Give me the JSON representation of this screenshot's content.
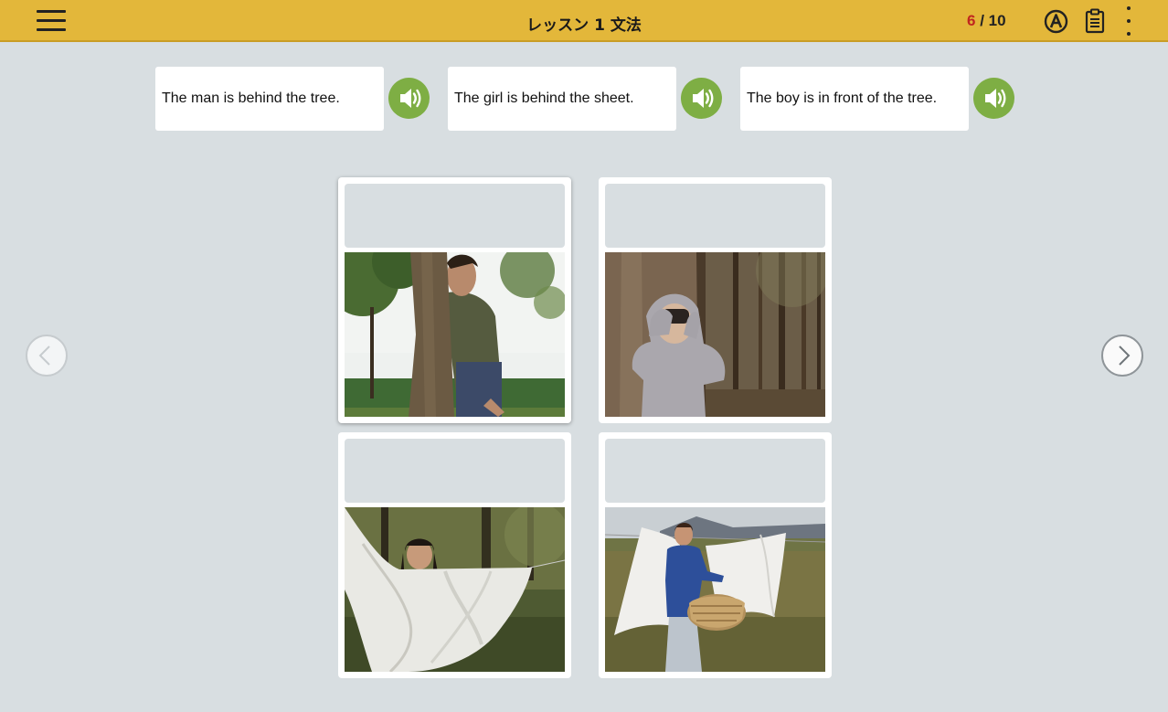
{
  "header": {
    "title": "レッスン 1 文法",
    "progress_current": "6",
    "progress_separator": " / ",
    "progress_total": "10",
    "icons": [
      "menu-icon",
      "answer-a-icon",
      "clipboard-icon",
      "more-vertical-icon"
    ]
  },
  "sentences": [
    {
      "text": "The man is behind the tree.",
      "icon": "speaker-icon"
    },
    {
      "text": "The girl is behind the sheet.",
      "icon": "speaker-icon"
    },
    {
      "text": "The boy is in front of the tree.",
      "icon": "speaker-icon"
    }
  ],
  "cards": [
    {
      "photo": "man peeking from behind a tree trunk",
      "selected": true
    },
    {
      "photo": "hooded boy with binoculars in front of a tree"
    },
    {
      "photo": "girl peeking behind a white sheet on a clothesline"
    },
    {
      "photo": "woman hanging a white sheet holding a basket"
    }
  ],
  "navigation": {
    "prev_icon": "chevron-left-icon",
    "next_icon": "chevron-right-icon"
  },
  "colors": {
    "header": "#e3b73a",
    "speaker": "#7eae44",
    "progress_current": "#c0261f",
    "background": "#d8dee1"
  }
}
